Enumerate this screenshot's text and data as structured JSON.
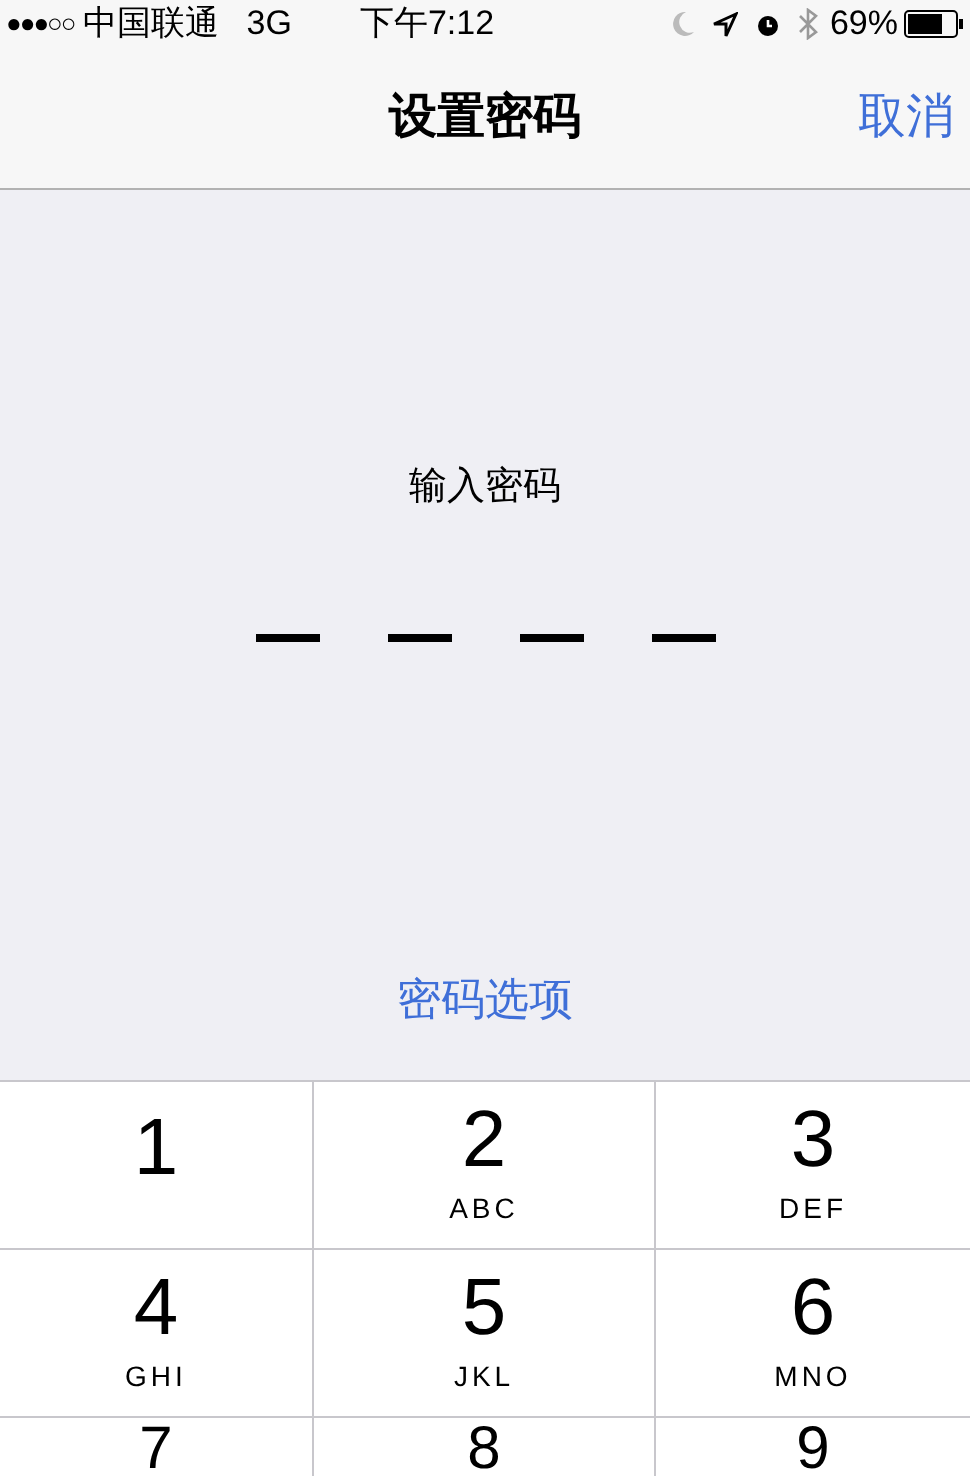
{
  "status_bar": {
    "signal": "●●●○○",
    "carrier": "中国联通",
    "network": "3G",
    "time": "下午7:12",
    "battery": "69%"
  },
  "nav": {
    "title": "设置密码",
    "cancel": "取消"
  },
  "prompt": "输入密码",
  "slots": [
    {
      "filled": false
    },
    {
      "filled": false
    },
    {
      "filled": false
    },
    {
      "filled": false
    }
  ],
  "options_link": "密码选项",
  "keypad": [
    {
      "digit": "1"
    },
    {
      "digit": "2",
      "letters": "ABC"
    },
    {
      "digit": "3",
      "letters": "DEF"
    },
    {
      "digit": "4",
      "letters": "GHI"
    },
    {
      "digit": "5",
      "letters": "JKL"
    },
    {
      "digit": "6",
      "letters": "MNO"
    },
    {
      "digit": "7"
    },
    {
      "digit": "8"
    },
    {
      "digit": "9"
    }
  ]
}
